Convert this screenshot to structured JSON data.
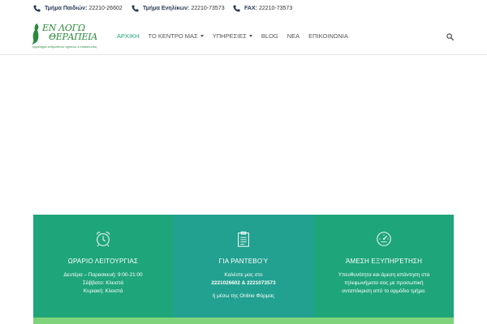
{
  "topbar": {
    "children": {
      "label": "Τμήμα Παιδιών:",
      "value": "22210-26602"
    },
    "adults": {
      "label": "Τμήμα Ενηλίκων:",
      "value": "22210-73573"
    },
    "fax": {
      "label": "FAX:",
      "value": "22210-73573"
    }
  },
  "logo": {
    "line1": "ΕΝ ΛΟΓΩ",
    "line2": "ΘΕΡΑΠΕΙΑ",
    "tagline": "εργαστήριο ανθρώπινων σχέσεων & επικοινωνίας"
  },
  "nav": {
    "items": [
      {
        "label": "ΑΡΧΙΚΗ",
        "active": true,
        "dropdown": false
      },
      {
        "label": "ΤΟ ΚΕΝΤΡΟ ΜΑΣ",
        "active": false,
        "dropdown": true
      },
      {
        "label": "ΥΠΗΡΕΣΙΕΣ",
        "active": false,
        "dropdown": true
      },
      {
        "label": "BLOG",
        "active": false,
        "dropdown": false
      },
      {
        "label": "ΝΕΑ",
        "active": false,
        "dropdown": false
      },
      {
        "label": "ΕΠΙΚΟΙΝΩΝΙΑ",
        "active": false,
        "dropdown": false
      }
    ],
    "search_icon": "search-icon"
  },
  "cards": [
    {
      "icon": "alarm-clock-icon",
      "title": "ΩΡΑΡΙΟ ΛΕΙΤΟΥΡΓΙΑΣ",
      "lines": [
        "Δευτέρα – Παρασκευή: 9:00-21:00",
        "Σάββατο: Κλειστά",
        "Κυριακή: Κλειστά"
      ]
    },
    {
      "icon": "clipboard-icon",
      "title": "ΓΙΑ ΡΑΝΤΕΒΟΎ",
      "lines": [
        "Καλέστε μας στο",
        "2221026602 & 2221073573"
      ],
      "extra": "ή μέσω της Online Φόρμας"
    },
    {
      "icon": "gauge-icon",
      "title": "ΆΜΕΣΗ ΕΞΥΠΗΡΈΤΗΣΗ",
      "lines": [
        "Υπευθυνότητα και άμεση απάντηση στα",
        "τηλεφωνήματα σας με προσωπική",
        "ανταπόκριση από το αρμόδιο τμήμα."
      ]
    }
  ],
  "colors": {
    "accent": "#1fa57a",
    "card_middle": "#22a090",
    "strip": "#7fd37a",
    "logo_green": "#2a8a3c"
  }
}
